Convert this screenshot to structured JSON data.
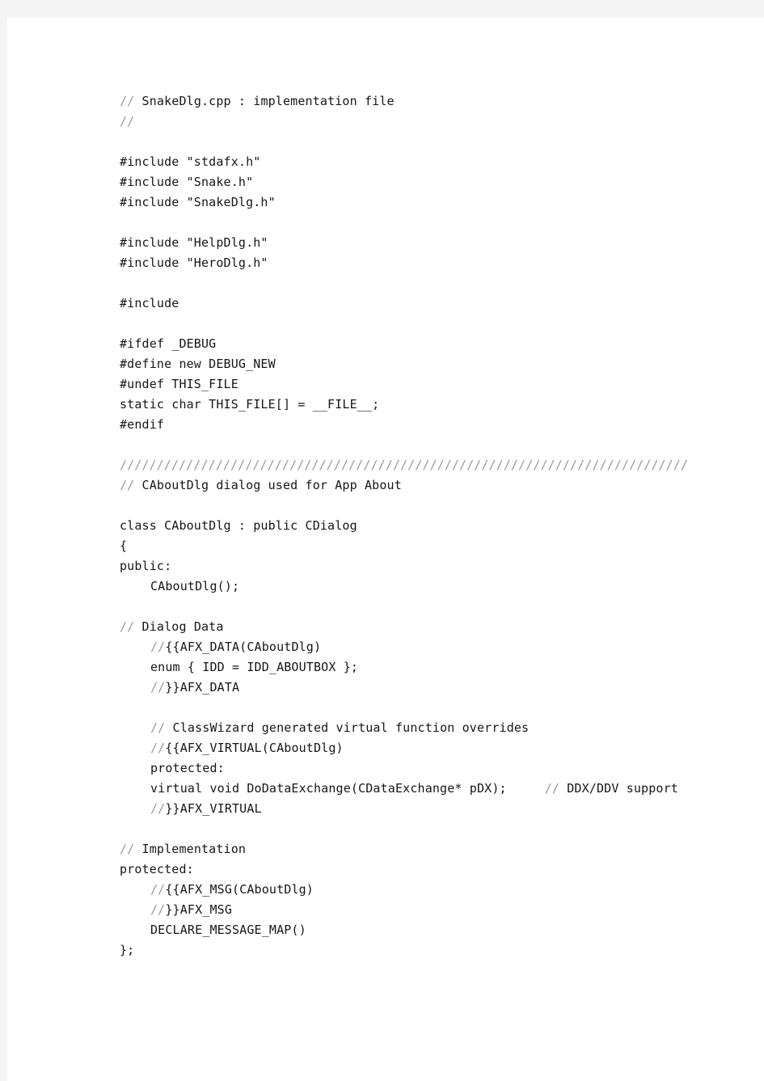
{
  "document": {
    "kind": "source-code-listing",
    "language": "C++",
    "file_name": "SnakeDlg.cpp",
    "page_background": "#f4f4f4",
    "sheet_background": "#ffffff",
    "text_color": "#15161a",
    "comment_color": "#9a9aa0"
  },
  "code": {
    "lines": [
      {
        "id": "l01",
        "indent": 0,
        "comment_prefix": "//",
        "text": " SnakeDlg.cpp : implementation file"
      },
      {
        "id": "l02",
        "indent": 0,
        "comment_prefix": "//",
        "text": ""
      },
      {
        "id": "l03",
        "indent": 0,
        "blank": true,
        "text": ""
      },
      {
        "id": "l04",
        "indent": 0,
        "text": "#include \"stdafx.h\""
      },
      {
        "id": "l05",
        "indent": 0,
        "text": "#include \"Snake.h\""
      },
      {
        "id": "l06",
        "indent": 0,
        "text": "#include \"SnakeDlg.h\""
      },
      {
        "id": "l07",
        "indent": 0,
        "blank": true,
        "text": ""
      },
      {
        "id": "l08",
        "indent": 0,
        "text": "#include \"HelpDlg.h\""
      },
      {
        "id": "l09",
        "indent": 0,
        "text": "#include \"HeroDlg.h\""
      },
      {
        "id": "l10",
        "indent": 0,
        "blank": true,
        "text": ""
      },
      {
        "id": "l11",
        "indent": 0,
        "text": "#include"
      },
      {
        "id": "l12",
        "indent": 0,
        "blank": true,
        "text": ""
      },
      {
        "id": "l13",
        "indent": 0,
        "text": "#ifdef _DEBUG"
      },
      {
        "id": "l14",
        "indent": 0,
        "text": "#define new DEBUG_NEW"
      },
      {
        "id": "l15",
        "indent": 0,
        "text": "#undef THIS_FILE"
      },
      {
        "id": "l16",
        "indent": 0,
        "text": "static char THIS_FILE[] = __FILE__;"
      },
      {
        "id": "l17",
        "indent": 0,
        "text": "#endif"
      },
      {
        "id": "l18",
        "indent": 0,
        "blank": true,
        "text": ""
      },
      {
        "id": "l19",
        "indent": 0,
        "rule": true,
        "text": "/////////////////////////////////////////////////////////////////////////////"
      },
      {
        "id": "l20",
        "indent": 0,
        "comment_prefix": "//",
        "text": " CAboutDlg dialog used for App About"
      },
      {
        "id": "l21",
        "indent": 0,
        "blank": true,
        "text": ""
      },
      {
        "id": "l22",
        "indent": 0,
        "text": "class CAboutDlg : public CDialog"
      },
      {
        "id": "l23",
        "indent": 0,
        "text": "{"
      },
      {
        "id": "l24",
        "indent": 0,
        "text": "public:"
      },
      {
        "id": "l25",
        "indent": 1,
        "text": "CAboutDlg();"
      },
      {
        "id": "l26",
        "indent": 0,
        "blank": true,
        "text": ""
      },
      {
        "id": "l27",
        "indent": 0,
        "comment_prefix": "//",
        "text": " Dialog Data"
      },
      {
        "id": "l28",
        "indent": 1,
        "comment_prefix": "//",
        "text": "{{AFX_DATA(CAboutDlg)"
      },
      {
        "id": "l29",
        "indent": 1,
        "text": "enum { IDD = IDD_ABOUTBOX };"
      },
      {
        "id": "l30",
        "indent": 1,
        "comment_prefix": "//",
        "text": "}}AFX_DATA"
      },
      {
        "id": "l31",
        "indent": 0,
        "blank": true,
        "text": ""
      },
      {
        "id": "l32",
        "indent": 1,
        "comment_prefix": "//",
        "text": " ClassWizard generated virtual function overrides"
      },
      {
        "id": "l33",
        "indent": 1,
        "comment_prefix": "//",
        "text": "{{AFX_VIRTUAL(CAboutDlg)"
      },
      {
        "id": "l34",
        "indent": 1,
        "text": "protected:"
      },
      {
        "id": "l35",
        "indent": 1,
        "text": "virtual void DoDataExchange(CDataExchange* pDX);",
        "trailing_comment_prefix": "//",
        "trailing_comment": " DDX/DDV support"
      },
      {
        "id": "l36",
        "indent": 1,
        "comment_prefix": "//",
        "text": "}}AFX_VIRTUAL"
      },
      {
        "id": "l37",
        "indent": 0,
        "blank": true,
        "text": ""
      },
      {
        "id": "l38",
        "indent": 0,
        "comment_prefix": "//",
        "text": " Implementation"
      },
      {
        "id": "l39",
        "indent": 0,
        "text": "protected:"
      },
      {
        "id": "l40",
        "indent": 1,
        "comment_prefix": "//",
        "text": "{{AFX_MSG(CAboutDlg)"
      },
      {
        "id": "l41",
        "indent": 1,
        "comment_prefix": "//",
        "text": "}}AFX_MSG"
      },
      {
        "id": "l42",
        "indent": 1,
        "text": "DECLARE_MESSAGE_MAP()"
      },
      {
        "id": "l43",
        "indent": 0,
        "text": "};"
      }
    ]
  }
}
